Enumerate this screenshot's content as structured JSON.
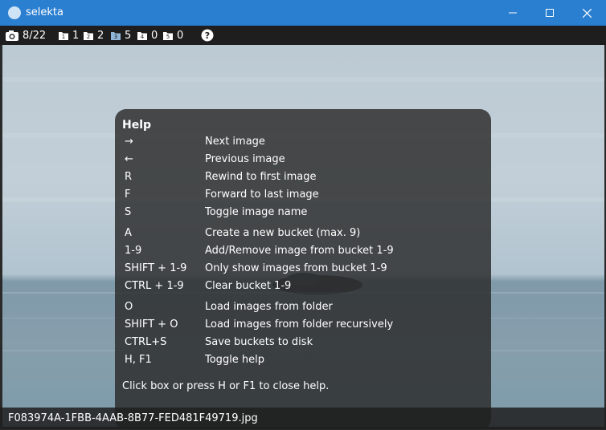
{
  "window": {
    "title": "selekta"
  },
  "toolbar": {
    "counter": "8/22",
    "buckets": [
      {
        "label": "1",
        "icon": "bucket-1-icon"
      },
      {
        "label": "2",
        "icon": "bucket-2-icon"
      },
      {
        "label": "5",
        "icon": "bucket-3-icon"
      },
      {
        "label": "0",
        "icon": "bucket-4-icon"
      },
      {
        "label": "0",
        "icon": "bucket-5-icon"
      }
    ]
  },
  "help": {
    "title": "Help",
    "rows": [
      {
        "key": "→",
        "desc": "Next image"
      },
      {
        "key": "←",
        "desc": "Previous image"
      },
      {
        "key": "R",
        "desc": "Rewind to first image"
      },
      {
        "key": "F",
        "desc": "Forward to last image"
      },
      {
        "key": "S",
        "desc": "Toggle image name"
      },
      {
        "key": "A",
        "desc": "Create a new bucket (max. 9)"
      },
      {
        "key": "1-9",
        "desc": "Add/Remove image from bucket 1-9"
      },
      {
        "key": "SHIFT + 1-9",
        "desc": "Only show images from bucket 1-9"
      },
      {
        "key": "CTRL + 1-9",
        "desc": "Clear bucket 1-9"
      },
      {
        "key": "O",
        "desc": "Load images from folder"
      },
      {
        "key": "SHIFT + O",
        "desc": "Load images from folder recursively"
      },
      {
        "key": "CTRL+S",
        "desc": "Save buckets to disk"
      },
      {
        "key": "H, F1",
        "desc": "Toggle help"
      }
    ],
    "footer": "Click box or press H or F1 to close help."
  },
  "status": {
    "filename": "F083974A-1FBB-4AAB-8B77-FED481F49719.jpg"
  }
}
